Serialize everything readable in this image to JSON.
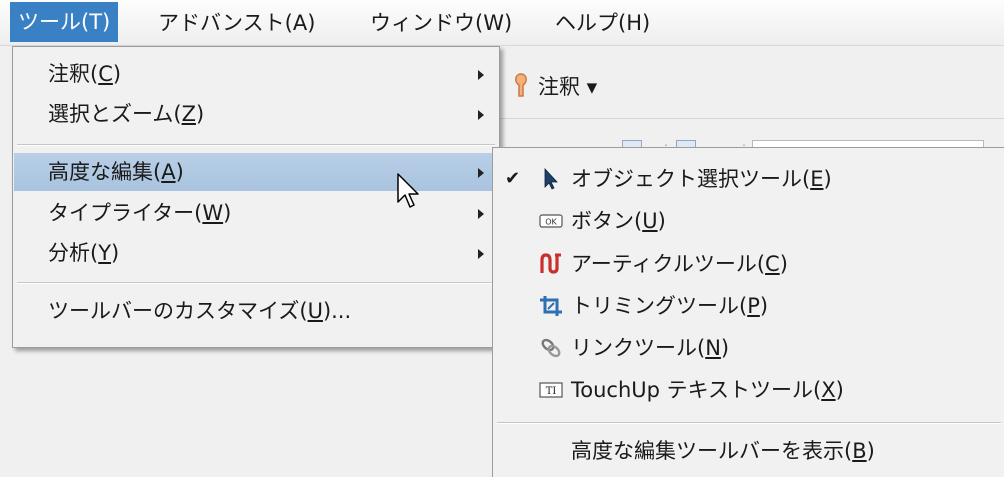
{
  "menubar": {
    "items": [
      {
        "label": "ツール(T)"
      },
      {
        "label": "アドバンスト(A)"
      },
      {
        "label": "ウィンドウ(W)"
      },
      {
        "label": "ヘルプ(H)"
      }
    ]
  },
  "toolbar": {
    "annotation_label": "注釈 ▾"
  },
  "tools_menu": {
    "items": [
      {
        "text": "注釈(",
        "key": "C",
        "tail": ")"
      },
      {
        "text": "選択とズーム(",
        "key": "Z",
        "tail": ")"
      },
      {
        "text": "高度な編集(",
        "key": "A",
        "tail": ")"
      },
      {
        "text": "タイプライター(",
        "key": "W",
        "tail": ")"
      },
      {
        "text": "分析(",
        "key": "Y",
        "tail": ")"
      },
      {
        "text": "ツールバーのカスタマイズ(",
        "key": "U",
        "tail": ")..."
      }
    ]
  },
  "advanced_editing_submenu": {
    "check": "✔",
    "items": [
      {
        "text": "オブジェクト選択ツール(",
        "key": "E",
        "tail": ")",
        "icon": "pointer-arrow-icon",
        "checked": true
      },
      {
        "text": "ボタン(",
        "key": "U",
        "tail": ")",
        "icon": "ok-button-icon"
      },
      {
        "text": "アーティクルツール(",
        "key": "C",
        "tail": ")",
        "icon": "article-icon"
      },
      {
        "text": "トリミングツール(",
        "key": "P",
        "tail": ")",
        "icon": "crop-icon"
      },
      {
        "text": "リンクツール(",
        "key": "N",
        "tail": ")",
        "icon": "link-icon"
      },
      {
        "text": "TouchUp テキストツール(",
        "key": "X",
        "tail": ")",
        "icon": "touchup-text-icon"
      },
      {
        "text": "高度な編集ツールバーを表示(",
        "key": "B",
        "tail": ")"
      }
    ],
    "ok_icon_text": "OK",
    "touchup_icon_text": "TI"
  },
  "colors": {
    "menubar_active": "#3a80c4",
    "highlight": "#a9c3df"
  }
}
